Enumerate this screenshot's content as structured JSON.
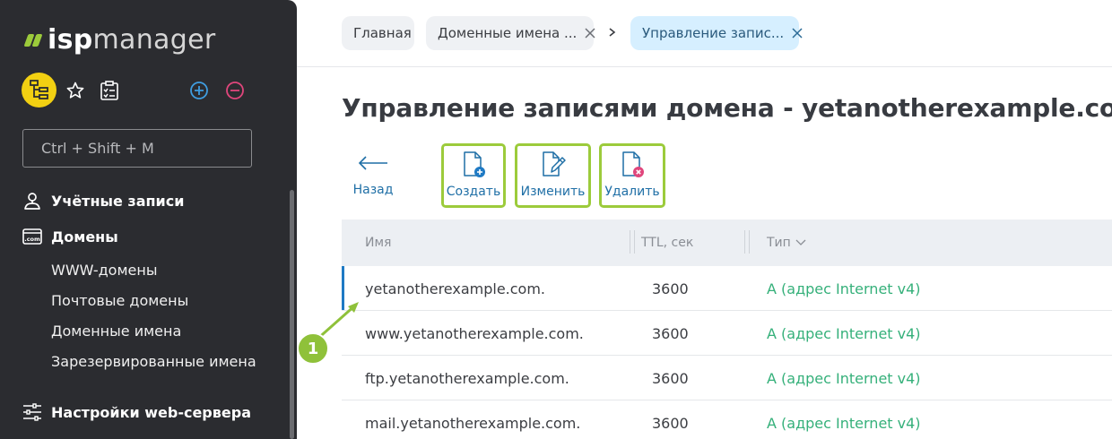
{
  "sidebar": {
    "logo": {
      "isp": "isp",
      "manager": "manager"
    },
    "search_placeholder": "Ctrl + Shift + M",
    "nav": {
      "accounts": "Учётные записи",
      "domains": "Домены",
      "sub": [
        "WWW-домены",
        "Почтовые домены",
        "Доменные имена",
        "Зарезервированные имена"
      ],
      "webserver": "Настройки web-сервера"
    }
  },
  "breadcrumbs": {
    "home": "Главная",
    "domains": "Доменные имена ...",
    "active": "Управление запис..."
  },
  "page_title": "Управление записями домена - yetanotherexample.com",
  "toolbar": {
    "back": "Назад",
    "create": "Создать",
    "edit": "Изменить",
    "delete": "Удалить"
  },
  "table": {
    "columns": {
      "name": "Имя",
      "ttl": "TTL, сек",
      "type": "Тип"
    },
    "rows": [
      {
        "name": "yetanotherexample.com.",
        "ttl": "3600",
        "type": "A (адрес Internet v4)"
      },
      {
        "name": "www.yetanotherexample.com.",
        "ttl": "3600",
        "type": "A (адрес Internet v4)"
      },
      {
        "name": "ftp.yetanotherexample.com.",
        "ttl": "3600",
        "type": "A (адрес Internet v4)"
      },
      {
        "name": "mail.yetanotherexample.com.",
        "ttl": "3600",
        "type": "A (адрес Internet v4)"
      }
    ]
  },
  "callout": "1",
  "colors": {
    "sidebar_bg": "#2b2c30",
    "accent_green": "#9ccb3b",
    "link_blue": "#1f6fa6",
    "type_green": "#35b07a",
    "active_crumb": "#d6efff",
    "tree_button": "#f2d012"
  }
}
